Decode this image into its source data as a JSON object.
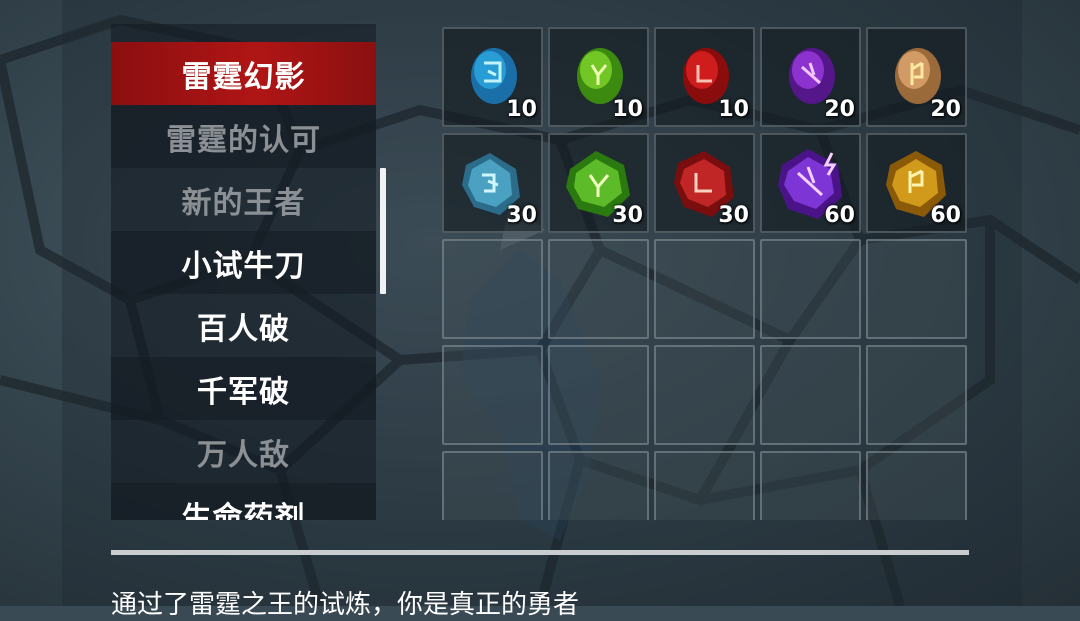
{
  "quests": [
    {
      "label": "雷霆幻影",
      "state": "active"
    },
    {
      "label": "雷霆的认可",
      "state": "done"
    },
    {
      "label": "新的王者",
      "state": "done"
    },
    {
      "label": "小试牛刀",
      "state": "open"
    },
    {
      "label": "百人破",
      "state": "open"
    },
    {
      "label": "千军破",
      "state": "open"
    },
    {
      "label": "万人敌",
      "state": "done"
    },
    {
      "label": "生命药剂",
      "state": "open"
    }
  ],
  "rewards": [
    {
      "icon": "blue-rune-stone-icon",
      "color": "#2aa8e0",
      "count": "10"
    },
    {
      "icon": "green-rune-stone-icon",
      "color": "#6fc21a",
      "count": "10"
    },
    {
      "icon": "red-rune-stone-icon",
      "color": "#d01818",
      "count": "10"
    },
    {
      "icon": "purple-rune-stone-icon",
      "color": "#8a2ad0",
      "count": "20"
    },
    {
      "icon": "orange-rune-stone-icon",
      "color": "#d89050",
      "count": "20"
    },
    {
      "icon": "blue-rune-crystal-icon",
      "color": "#3aa0c8",
      "count": "30"
    },
    {
      "icon": "green-rune-crystal-icon",
      "color": "#4fb020",
      "count": "30"
    },
    {
      "icon": "red-rune-crystal-icon",
      "color": "#c82020",
      "count": "30"
    },
    {
      "icon": "purple-rune-crystal-icon",
      "color": "#7a30d8",
      "count": "60"
    },
    {
      "icon": "gold-rune-crystal-icon",
      "color": "#d8a018",
      "count": "60"
    }
  ],
  "description": "通过了雷霆之王的试炼，你是真正的勇者"
}
